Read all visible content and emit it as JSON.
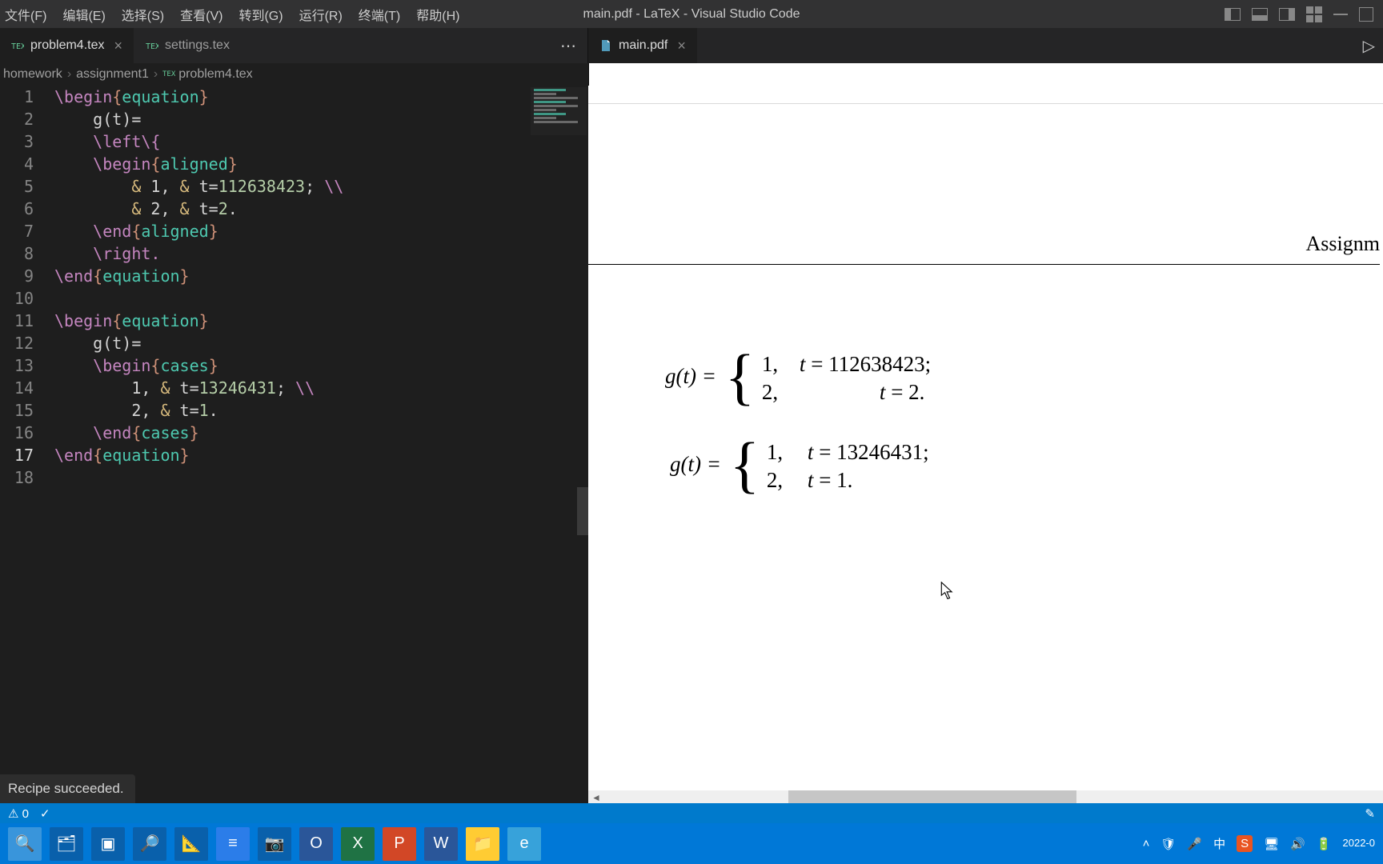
{
  "menubar": [
    "文件(F)",
    "编辑(E)",
    "选择(S)",
    "查看(V)",
    "转到(G)",
    "运行(R)",
    "终端(T)",
    "帮助(H)"
  ],
  "window_title": "main.pdf - LaTeX - Visual Studio Code",
  "tabs_left": [
    {
      "label": "problem4.tex",
      "active": true
    },
    {
      "label": "settings.tex",
      "active": false
    }
  ],
  "tabs_right": [
    {
      "label": "main.pdf",
      "active": true
    }
  ],
  "breadcrumbs": [
    "homework",
    "assignment1",
    "problem4.tex"
  ],
  "editor": {
    "lines": [
      {
        "n": 1,
        "segs": [
          [
            "\\begin",
            "kw"
          ],
          [
            "{",
            "curly"
          ],
          [
            "equation",
            "name"
          ],
          [
            "}",
            "curly"
          ]
        ]
      },
      {
        "n": 2,
        "segs": [
          [
            "    g(t)=",
            "punc"
          ]
        ]
      },
      {
        "n": 3,
        "segs": [
          [
            "    ",
            "punc"
          ],
          [
            "\\left\\{",
            "kw"
          ]
        ]
      },
      {
        "n": 4,
        "segs": [
          [
            "    ",
            "punc"
          ],
          [
            "\\begin",
            "kw"
          ],
          [
            "{",
            "curly"
          ],
          [
            "aligned",
            "name"
          ],
          [
            "}",
            "curly"
          ]
        ]
      },
      {
        "n": 5,
        "segs": [
          [
            "        ",
            "punc"
          ],
          [
            "&",
            "amp"
          ],
          [
            " 1, ",
            "punc"
          ],
          [
            "&",
            "amp"
          ],
          [
            " t=",
            "punc"
          ],
          [
            "112638423",
            "num"
          ],
          [
            "; ",
            "punc"
          ],
          [
            "\\\\",
            "kw"
          ]
        ]
      },
      {
        "n": 6,
        "segs": [
          [
            "        ",
            "punc"
          ],
          [
            "&",
            "amp"
          ],
          [
            " 2, ",
            "punc"
          ],
          [
            "&",
            "amp"
          ],
          [
            " t=",
            "punc"
          ],
          [
            "2",
            "num"
          ],
          [
            ".",
            "punc"
          ]
        ]
      },
      {
        "n": 7,
        "segs": [
          [
            "    ",
            "punc"
          ],
          [
            "\\end",
            "kw"
          ],
          [
            "{",
            "curly"
          ],
          [
            "aligned",
            "name"
          ],
          [
            "}",
            "curly"
          ]
        ]
      },
      {
        "n": 8,
        "segs": [
          [
            "    ",
            "punc"
          ],
          [
            "\\right.",
            "kw"
          ]
        ]
      },
      {
        "n": 9,
        "segs": [
          [
            "\\end",
            "kw"
          ],
          [
            "{",
            "curly"
          ],
          [
            "equation",
            "name"
          ],
          [
            "}",
            "curly"
          ]
        ]
      },
      {
        "n": 10,
        "segs": [
          [
            "",
            "punc"
          ]
        ]
      },
      {
        "n": 11,
        "segs": [
          [
            "\\begin",
            "kw"
          ],
          [
            "{",
            "curly"
          ],
          [
            "equation",
            "name"
          ],
          [
            "}",
            "curly"
          ]
        ]
      },
      {
        "n": 12,
        "segs": [
          [
            "    g(t)=",
            "punc"
          ]
        ]
      },
      {
        "n": 13,
        "segs": [
          [
            "    ",
            "punc"
          ],
          [
            "\\begin",
            "kw"
          ],
          [
            "{",
            "curly"
          ],
          [
            "cases",
            "name"
          ],
          [
            "}",
            "curly"
          ]
        ]
      },
      {
        "n": 14,
        "segs": [
          [
            "        1, ",
            "punc"
          ],
          [
            "&",
            "amp"
          ],
          [
            " t=",
            "punc"
          ],
          [
            "13246431",
            "num"
          ],
          [
            "; ",
            "punc"
          ],
          [
            "\\\\",
            "kw"
          ]
        ]
      },
      {
        "n": 15,
        "segs": [
          [
            "        2, ",
            "punc"
          ],
          [
            "&",
            "amp"
          ],
          [
            " t=",
            "punc"
          ],
          [
            "1",
            "num"
          ],
          [
            ".",
            "punc"
          ]
        ]
      },
      {
        "n": 16,
        "segs": [
          [
            "    ",
            "punc"
          ],
          [
            "\\end",
            "kw"
          ],
          [
            "{",
            "curly"
          ],
          [
            "cases",
            "name"
          ],
          [
            "}",
            "curly"
          ]
        ]
      },
      {
        "n": 17,
        "segs": [
          [
            "\\end",
            "kw"
          ],
          [
            "{",
            "curly"
          ],
          [
            "equation",
            "name"
          ],
          [
            "}",
            "curly"
          ]
        ]
      },
      {
        "n": 18,
        "segs": [
          [
            "",
            "punc"
          ]
        ]
      }
    ],
    "active_line": 17
  },
  "recipe_msg": "Recipe succeeded.",
  "pdf": {
    "header": "Assignm",
    "eq1": {
      "lhs": "g(t) =",
      "r1_a": "1,",
      "r1_b": "t = 112638423;",
      "r2_a": "2,",
      "r2_b": "t = 2."
    },
    "eq2": {
      "lhs": "g(t) =",
      "r1_a": "1,",
      "r1_b": "t = 13246431;",
      "r2_a": "2,",
      "r2_b": "t = 1."
    }
  },
  "status": {
    "warnings": "⚠ 0",
    "check": "✓"
  },
  "taskbar_time": "",
  "taskbar_date": "2022-0"
}
